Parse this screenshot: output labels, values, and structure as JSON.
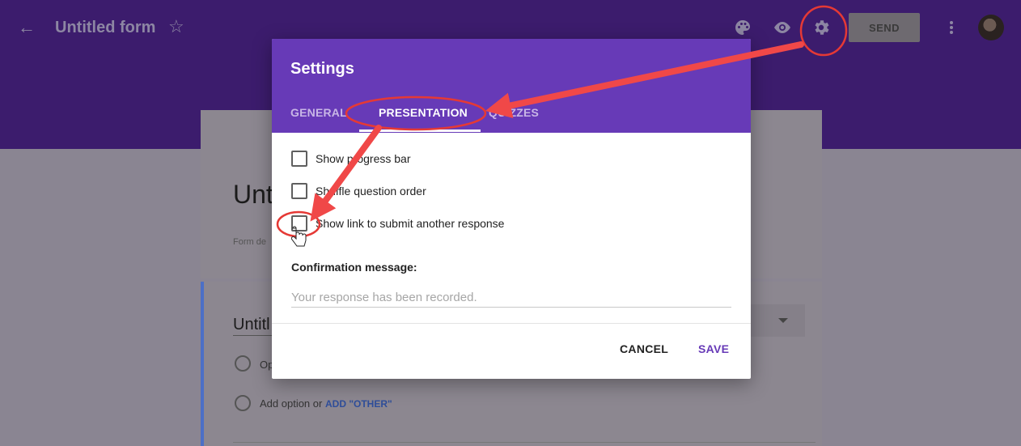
{
  "topbar": {
    "title": "Untitled form",
    "send_label": "SEND"
  },
  "form": {
    "heading": "Unti",
    "description": "Form de",
    "question_title": "Untitl",
    "option1": "Op",
    "add_option": "Add option",
    "or_text": "or",
    "add_other": "ADD \"OTHER\""
  },
  "dialog": {
    "title": "Settings",
    "tabs": [
      {
        "label": "GENERAL"
      },
      {
        "label": "PRESENTATION"
      },
      {
        "label": "QUIZZES"
      }
    ],
    "checkboxes": [
      {
        "label": "Show progress bar"
      },
      {
        "label": "Shuffle question order"
      },
      {
        "label": "Show link to submit another response"
      }
    ],
    "confirmation_label": "Confirmation message:",
    "confirmation_placeholder": "Your response has been recorded.",
    "cancel_label": "CANCEL",
    "save_label": "SAVE"
  },
  "colors": {
    "header_purple": "#673ab7",
    "annotation_red": "#f04848"
  }
}
